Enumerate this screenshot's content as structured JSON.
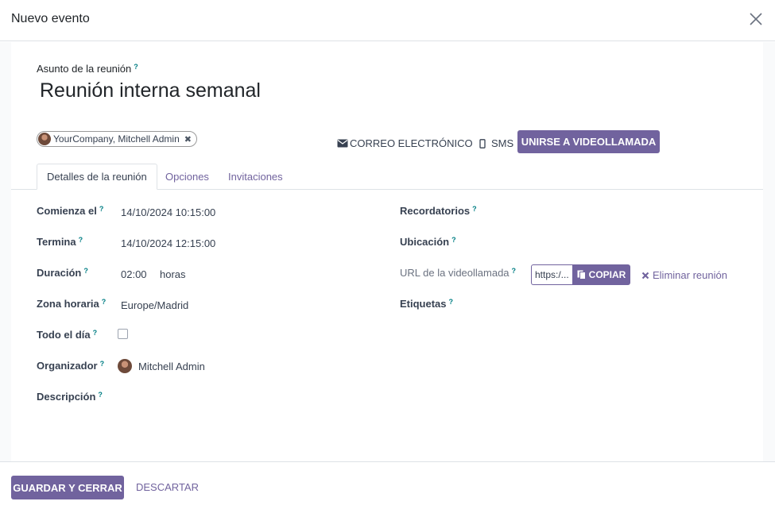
{
  "dialog": {
    "title": "Nuevo evento",
    "close_icon": "close-icon"
  },
  "subject": {
    "label": "Asunto de la reunión",
    "help": "?",
    "value": "Reunión interna semanal"
  },
  "attendees": [
    {
      "name": "YourCompany, Mitchell Admin",
      "remove": "✖"
    }
  ],
  "actions": {
    "email_label": "CORREO ELECTRÓNICO",
    "sms_label": "SMS",
    "join_video_label": "UNIRSE A VIDEOLLAMADA"
  },
  "tabs": [
    {
      "label": "Detalles de la reunión",
      "active": true
    },
    {
      "label": "Opciones",
      "active": false
    },
    {
      "label": "Invitaciones",
      "active": false
    }
  ],
  "left_fields": {
    "start": {
      "label": "Comienza el",
      "help": "?",
      "value": "14/10/2024 10:15:00"
    },
    "stop": {
      "label": "Termina",
      "help": "?",
      "value": "14/10/2024 12:15:00"
    },
    "duration": {
      "label": "Duración",
      "help": "?",
      "value": "02:00",
      "unit": "horas"
    },
    "timezone": {
      "label": "Zona horaria",
      "help": "?",
      "value": "Europe/Madrid"
    },
    "allday": {
      "label": "Todo el día",
      "help": "?",
      "checked": false
    },
    "organizer": {
      "label": "Organizador",
      "help": "?",
      "value": "Mitchell Admin"
    },
    "description": {
      "label": "Descripción",
      "help": "?"
    }
  },
  "right_fields": {
    "reminders": {
      "label": "Recordatorios",
      "help": "?"
    },
    "location": {
      "label": "Ubicación",
      "help": "?"
    },
    "video_url": {
      "label": "URL de la videollamada",
      "help": "?",
      "value": "https:/...",
      "copy_label": "COPIAR",
      "remove_label": "Eliminar reunión"
    },
    "tags": {
      "label": "Etiquetas",
      "help": "?"
    }
  },
  "footer": {
    "save_label": "GUARDAR Y CERRAR",
    "discard_label": "DESCARTAR"
  },
  "colors": {
    "primary": "#71639e",
    "help": "#017e84",
    "text": "#374151"
  }
}
